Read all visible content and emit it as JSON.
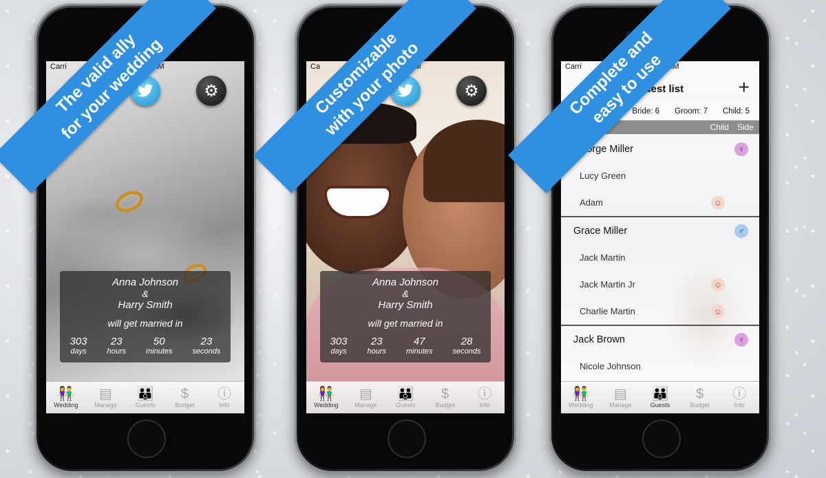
{
  "phones": [
    {
      "banner_lines": [
        "The valid ally",
        "for your wedding"
      ],
      "status": {
        "carrier": "Carri",
        "time": "50 AM"
      },
      "icons": {
        "facebook": "facebook-icon",
        "twitter": "twitter-icon",
        "settings": "gear-icon"
      },
      "card": {
        "name1": "Anna Johnson",
        "amp": "&",
        "name2": "Harry Smith",
        "caption": "will get married in"
      },
      "countdown": [
        {
          "value": "303",
          "unit": "days"
        },
        {
          "value": "23",
          "unit": "hours"
        },
        {
          "value": "50",
          "unit": "minutes"
        },
        {
          "value": "23",
          "unit": "seconds"
        }
      ],
      "tabs": [
        {
          "label": "Wedding",
          "icon": "couple-icon",
          "active": true
        },
        {
          "label": "Manage",
          "icon": "inbox-icon",
          "active": false
        },
        {
          "label": "Guests",
          "icon": "family-icon",
          "active": false
        },
        {
          "label": "Budget",
          "icon": "money-bag-icon",
          "active": false
        },
        {
          "label": "Info",
          "icon": "info-icon",
          "active": false
        }
      ]
    },
    {
      "banner_lines": [
        "Customizable",
        "with your photo"
      ],
      "status": {
        "carrier": "Ca",
        "time": "52 AM"
      },
      "icons": {
        "facebook": "facebook-icon",
        "twitter": "twitter-icon",
        "settings": "gear-icon"
      },
      "card": {
        "name1": "Anna Johnson",
        "amp": "&",
        "name2": "Harry Smith",
        "caption": "will get married in"
      },
      "countdown": [
        {
          "value": "303",
          "unit": "days"
        },
        {
          "value": "23",
          "unit": "hours"
        },
        {
          "value": "47",
          "unit": "minutes"
        },
        {
          "value": "28",
          "unit": "seconds"
        }
      ],
      "tabs": [
        {
          "label": "Wedding",
          "icon": "couple-icon",
          "active": true
        },
        {
          "label": "Manage",
          "icon": "inbox-icon",
          "active": false
        },
        {
          "label": "Guests",
          "icon": "family-icon",
          "active": false
        },
        {
          "label": "Budget",
          "icon": "money-bag-icon",
          "active": false
        },
        {
          "label": "Info",
          "icon": "info-icon",
          "active": false
        }
      ]
    },
    {
      "banner_lines": [
        "Complete and",
        "easy to use"
      ],
      "status": {
        "carrier": "Carri",
        "time": "50 AM"
      },
      "nav": {
        "title": "Guest list",
        "add": "+"
      },
      "counts": {
        "bride": "Bride: 6",
        "groom": "Groom: 7",
        "child": "Child: 5"
      },
      "columns": {
        "child": "Child",
        "side": "Side"
      },
      "groups": [
        {
          "main": "George Miller",
          "side_icon": "bride-icon",
          "members": [
            {
              "name": "Lucy Green",
              "child": false
            },
            {
              "name": "Adam",
              "child": true
            }
          ]
        },
        {
          "main": "Grace Miller",
          "side_icon": "groom-icon",
          "members": [
            {
              "name": "Jack Martin",
              "child": false
            },
            {
              "name": "Jack Martin Jr",
              "child": true
            },
            {
              "name": "Charlie Martin",
              "child": true
            }
          ]
        },
        {
          "main": "Jack Brown",
          "side_icon": "bride-icon",
          "members": [
            {
              "name": "Nicole Johnson",
              "child": false
            }
          ]
        }
      ],
      "tabs": [
        {
          "label": "Wedding",
          "icon": "couple-icon",
          "active": false
        },
        {
          "label": "Manage",
          "icon": "inbox-icon",
          "active": false
        },
        {
          "label": "Guests",
          "icon": "family-icon",
          "active": true
        },
        {
          "label": "Budget",
          "icon": "money-bag-icon",
          "active": false
        },
        {
          "label": "Info",
          "icon": "info-icon",
          "active": false
        }
      ]
    }
  ],
  "colors": {
    "banner": "#2f8fe0",
    "card": "#282828",
    "bride": "#d9a2de",
    "groom": "#a9cbef"
  }
}
